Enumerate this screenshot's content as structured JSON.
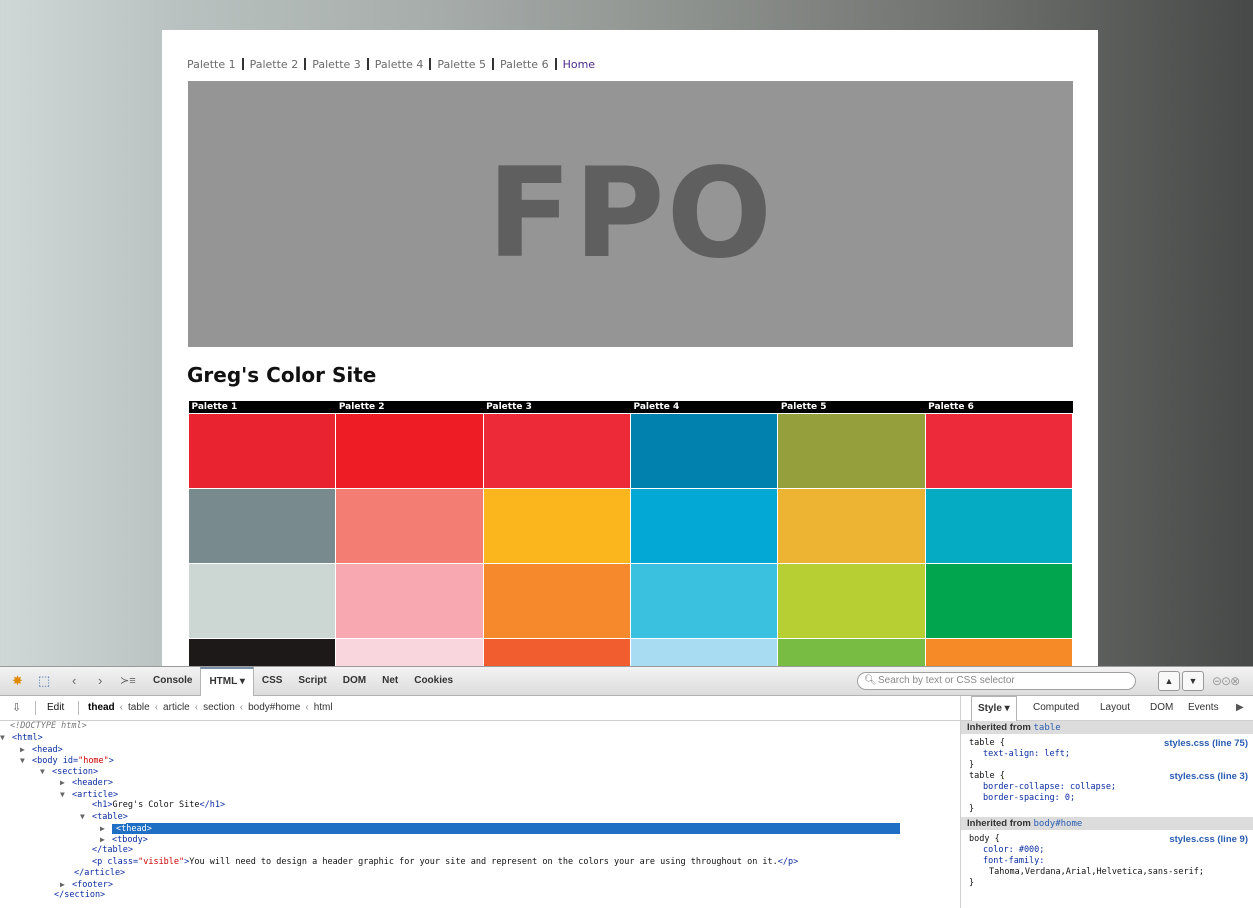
{
  "nav": {
    "items": [
      "Palette 1",
      "Palette 2",
      "Palette 3",
      "Palette 4",
      "Palette 5",
      "Palette 6",
      "Home"
    ]
  },
  "hero": {
    "text": "FPO"
  },
  "page_title": "Greg's Color Site",
  "palette_table": {
    "headers": [
      "Palette 1",
      "Palette 2",
      "Palette 3",
      "Palette 4",
      "Palette 5",
      "Palette 6"
    ],
    "rows": [
      [
        "#e9232f",
        "#ee1c25",
        "#ec2a38",
        "#0182ae",
        "#959f3b",
        "#ec2a39"
      ],
      [
        "#798a8f",
        "#f37d72",
        "#fbb51d",
        "#03a8d5",
        "#ecb432",
        "#05abc3"
      ],
      [
        "#ccd7d3",
        "#f7a8b0",
        "#f5892b",
        "#39c1df",
        "#b7cf33",
        "#00a54e"
      ],
      [
        "#1d1918",
        "#f9d6dd",
        "#f15d2e",
        "#a7dcf2",
        "#79bc43",
        "#f58a27"
      ]
    ]
  },
  "devtools": {
    "toolbar": {
      "tabs": [
        "Console",
        "HTML",
        "CSS",
        "Script",
        "DOM",
        "Net",
        "Cookies"
      ],
      "active_tab": "HTML",
      "html_tab_label": "HTML ▾",
      "search_placeholder": "Search by text or CSS selector"
    },
    "subbar": {
      "edit_label": "Edit",
      "breadcrumbs": [
        "thead",
        "table",
        "article",
        "section",
        "body#home",
        "html"
      ]
    },
    "tree": {
      "doctype": "<!DOCTYPE html>",
      "html_tag": "<html>",
      "head_tag": "<head>",
      "body_open": "<body",
      "body_attr": "id=",
      "body_val": "\"home\"",
      "section_tag": "<section>",
      "header_tag": "<header>",
      "article_tag": "<article>",
      "h1_open": "<h1>",
      "h1_text": "Greg's Color Site",
      "h1_close": "</h1>",
      "table_tag": "<table>",
      "thead_tag": "<thead>",
      "tbody_tag": "<tbody>",
      "table_close": "</table>",
      "p_open": "<p",
      "p_attr": "class=",
      "p_val": "\"visible\"",
      "p_text": "You will need to design a header graphic for your site and represent on the colors your are using throughout on it.",
      "p_close": "</p>",
      "article_close": "</article>",
      "footer_tag": "<footer>",
      "section_close": "</section>"
    },
    "side": {
      "tabs": [
        "Style ▾",
        "Computed",
        "Layout",
        "DOM",
        "Events"
      ],
      "inherited_table_label": "Inherited from",
      "inherited_table_sel": "table",
      "rule1": {
        "selector": "table {",
        "source": "styles.css (line 75)",
        "props": [
          "text-align: left;"
        ]
      },
      "rule2": {
        "selector": "table {",
        "source": "styles.css (line 3)",
        "props": [
          "border-collapse: collapse;",
          "border-spacing: 0;"
        ]
      },
      "inherited_body_label": "Inherited from",
      "inherited_body_sel": "body#home",
      "rule3": {
        "selector": "body {",
        "source": "styles.css (line 9)",
        "props": [
          "color: #000;",
          "font-family:",
          "Tahoma,Verdana,Arial,Helvetica,sans-serif;"
        ]
      },
      "close_brace": "}"
    }
  }
}
